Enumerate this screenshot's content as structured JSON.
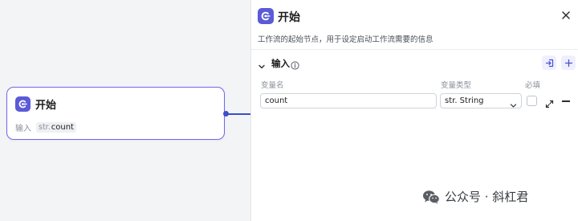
{
  "node": {
    "title": "开始",
    "input_label": "输入",
    "variable_type": "str.",
    "variable_name": "count"
  },
  "panel": {
    "title": "开始",
    "description": "工作流的起始节点，用于设定启动工作流需要的信息",
    "section_title": "输入",
    "columns": {
      "name": "变量名",
      "type": "变量类型",
      "required": "必填"
    },
    "row": {
      "name_value": "count",
      "type_value": "str. String"
    }
  },
  "watermark": {
    "text": "公众号 · 斜杠君"
  },
  "colors": {
    "accent": "#5b5bd6",
    "edge": "#3c4ec8",
    "node_border": "#6f67f0"
  },
  "icons": [
    "start-node-icon",
    "close-icon",
    "chevron-down-icon",
    "info-icon",
    "import-icon",
    "plus-icon",
    "expand-icon",
    "minus-icon",
    "wechat-logo"
  ]
}
